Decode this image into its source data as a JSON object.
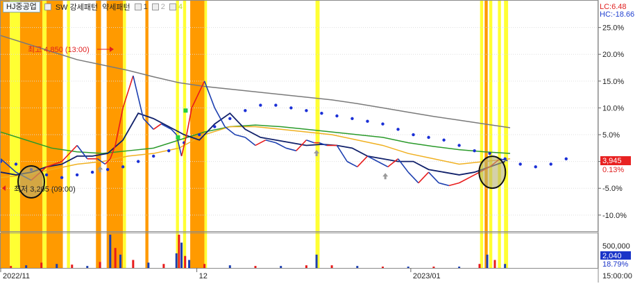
{
  "toolbar": {
    "symbol": "HJ중공업",
    "items": [
      "SW 강세패턴",
      "약세패턴"
    ],
    "series_nums": [
      "1",
      "2",
      "4"
    ],
    "series_colors": [
      "#444444",
      "#aaaaaa",
      "#b8d830"
    ]
  },
  "top_right": {
    "lc_label": "LC:6.48",
    "hc_label": "HC:-18.66",
    "lc_color": "#e02020",
    "hc_color": "#2040d0"
  },
  "annotations": {
    "high_label": "최고 4,850 (13:00)",
    "low_label": "최저 3,205 (09:00)"
  },
  "price_tag": {
    "value": "3,945",
    "pct": "0.13%"
  },
  "volume_tags": {
    "max": "500,000",
    "value": "2,040",
    "pct": "18.79%"
  },
  "time_label": "15:00:00",
  "colors": {
    "band_yellow": "#ffff33",
    "band_orange": "#ff9a00",
    "price_up": "#e81b1b",
    "price_down": "#1c3fb0",
    "dots": "#1a2fd6",
    "ma_gray": "#7a7a7a",
    "ma_green": "#2a9a2a",
    "ma_orange": "#f0b020",
    "ma_navy": "#10206a",
    "ma_pink": "#d040c0"
  },
  "chart_data": {
    "type": "line",
    "y_axis_ticks": [
      "25.0%",
      "20.0%",
      "15.0%",
      "10.0%",
      "5.0%",
      "0.0%",
      "-5.0%",
      "-10.0%"
    ],
    "y_tick_values": [
      25,
      20,
      15,
      10,
      5,
      0,
      -5,
      -10
    ],
    "ylim": [
      -13,
      30
    ],
    "x_axis_labels": [
      "2022/11",
      "12",
      "2023/01"
    ],
    "x_axis_positions": [
      0.0,
      0.385,
      0.805
    ],
    "xlim": [
      0,
      1
    ],
    "volume_axis_tick": "500,000",
    "series": [
      {
        "kind": "price",
        "x": [
          0.0,
          0.03,
          0.06,
          0.09,
          0.12,
          0.15,
          0.17,
          0.19,
          0.205,
          0.215,
          0.225,
          0.24,
          0.26,
          0.28,
          0.3,
          0.315,
          0.325,
          0.335,
          0.345,
          0.355,
          0.365,
          0.375,
          0.385,
          0.4,
          0.42,
          0.44,
          0.46,
          0.48,
          0.5,
          0.52,
          0.54,
          0.56,
          0.58,
          0.6,
          0.615,
          0.625,
          0.64,
          0.66,
          0.68,
          0.7,
          0.72,
          0.74,
          0.76,
          0.78,
          0.8,
          0.82,
          0.84,
          0.86,
          0.88,
          0.9,
          0.92,
          0.94,
          0.96,
          0.98,
          0.995
        ],
        "values": [
          0.5,
          -2.0,
          -3.5,
          -1.0,
          0.0,
          3.0,
          0.5,
          0.5,
          -0.5,
          0.5,
          3.0,
          10.0,
          16.0,
          8.0,
          6.0,
          7.0,
          6.5,
          6.0,
          5.0,
          1.0,
          5.0,
          10.0,
          12.0,
          15.0,
          10.0,
          6.5,
          5.0,
          4.5,
          3.0,
          4.0,
          3.5,
          2.5,
          2.0,
          4.0,
          3.5,
          3.5,
          3.0,
          3.0,
          0.0,
          -1.0,
          1.0,
          0.0,
          -1.0,
          0.5,
          -2.0,
          -4.0,
          -2.0,
          -4.0,
          -4.5,
          -4.0,
          -3.0,
          -2.0,
          -1.0,
          0.5,
          0.13
        ]
      },
      {
        "kind": "ma_gray",
        "x": [
          0.0,
          0.05,
          0.1,
          0.15,
          0.2,
          0.25,
          0.3,
          0.35,
          0.4,
          0.45,
          0.5,
          0.55,
          0.6,
          0.65,
          0.7,
          0.75,
          0.8,
          0.85,
          0.9,
          0.95,
          1.0
        ],
        "values": [
          23.5,
          22.0,
          20.5,
          19.0,
          18.0,
          17.0,
          15.8,
          14.7,
          14.0,
          13.5,
          13.0,
          12.5,
          12.0,
          11.5,
          10.8,
          10.0,
          9.2,
          8.4,
          7.7,
          7.0,
          6.3
        ]
      },
      {
        "kind": "ma_green",
        "x": [
          0.0,
          0.05,
          0.1,
          0.15,
          0.2,
          0.25,
          0.3,
          0.35,
          0.4,
          0.45,
          0.5,
          0.55,
          0.6,
          0.65,
          0.7,
          0.75,
          0.8,
          0.85,
          0.9,
          0.95,
          1.0
        ],
        "values": [
          5.5,
          4.0,
          2.5,
          1.8,
          1.5,
          2.0,
          2.5,
          4.0,
          5.5,
          6.5,
          6.8,
          6.5,
          6.0,
          5.5,
          5.0,
          4.5,
          3.5,
          2.8,
          2.2,
          1.8,
          1.5
        ]
      },
      {
        "kind": "ma_orange",
        "x": [
          0.0,
          0.05,
          0.1,
          0.15,
          0.2,
          0.25,
          0.3,
          0.35,
          0.4,
          0.45,
          0.5,
          0.55,
          0.6,
          0.65,
          0.7,
          0.75,
          0.8,
          0.85,
          0.9,
          0.95,
          1.0
        ],
        "values": [
          -3.0,
          -2.5,
          -1.5,
          -0.5,
          0.0,
          1.0,
          1.5,
          2.5,
          5.0,
          6.5,
          6.5,
          6.0,
          5.5,
          5.0,
          4.0,
          3.0,
          1.5,
          0.5,
          -0.5,
          0.0,
          0.5
        ]
      },
      {
        "kind": "ma_navy",
        "x": [
          0.0,
          0.03,
          0.06,
          0.09,
          0.12,
          0.15,
          0.18,
          0.21,
          0.24,
          0.27,
          0.3,
          0.33,
          0.36,
          0.39,
          0.42,
          0.45,
          0.48,
          0.51,
          0.54,
          0.57,
          0.6,
          0.63,
          0.66,
          0.69,
          0.72,
          0.75,
          0.78,
          0.81,
          0.84,
          0.87,
          0.9,
          0.93,
          0.96,
          0.99
        ],
        "values": [
          -2.0,
          -2.5,
          -2.0,
          -1.0,
          -0.5,
          1.0,
          1.0,
          1.5,
          4.0,
          9.0,
          8.0,
          6.5,
          5.0,
          4.0,
          7.0,
          9.0,
          6.0,
          4.5,
          4.0,
          3.5,
          3.0,
          3.2,
          3.0,
          2.5,
          1.0,
          0.5,
          0.0,
          0.0,
          -1.5,
          -2.0,
          -2.5,
          -2.0,
          -1.0,
          0.0
        ]
      },
      {
        "kind": "dots",
        "x": [
          0.0,
          0.03,
          0.06,
          0.09,
          0.12,
          0.15,
          0.18,
          0.21,
          0.24,
          0.27,
          0.3,
          0.33,
          0.36,
          0.39,
          0.42,
          0.45,
          0.48,
          0.51,
          0.54,
          0.57,
          0.6,
          0.63,
          0.66,
          0.69,
          0.72,
          0.75,
          0.78,
          0.81,
          0.84,
          0.87,
          0.9,
          0.93,
          0.96,
          0.99,
          1.02,
          1.05,
          1.08,
          1.11,
          1.14
        ],
        "values": [
          0.0,
          -0.5,
          -1.5,
          -2.5,
          -3.0,
          -2.5,
          -2.0,
          -1.5,
          -1.0,
          0.0,
          1.0,
          2.0,
          3.5,
          5.0,
          6.5,
          8.0,
          9.5,
          10.5,
          10.5,
          10.0,
          9.5,
          9.0,
          8.5,
          8.0,
          7.5,
          7.0,
          6.0,
          5.0,
          4.5,
          4.0,
          3.0,
          2.0,
          1.5,
          0.5,
          -0.5,
          -1.0,
          -0.5,
          0.5,
          1.0
        ]
      }
    ],
    "bands": [
      {
        "x0": 0.0,
        "x1": 0.018,
        "color": "orange"
      },
      {
        "x0": 0.018,
        "x1": 0.038,
        "color": "yellow"
      },
      {
        "x0": 0.038,
        "x1": 0.082,
        "color": "orange"
      },
      {
        "x0": 0.082,
        "x1": 0.09,
        "color": "yellow"
      },
      {
        "x0": 0.09,
        "x1": 0.122,
        "color": "orange"
      },
      {
        "x0": 0.13,
        "x1": 0.136,
        "color": "yellow"
      },
      {
        "x0": 0.187,
        "x1": 0.197,
        "color": "orange"
      },
      {
        "x0": 0.208,
        "x1": 0.24,
        "color": "orange"
      },
      {
        "x0": 0.24,
        "x1": 0.246,
        "color": "yellow"
      },
      {
        "x0": 0.284,
        "x1": 0.29,
        "color": "orange"
      },
      {
        "x0": 0.344,
        "x1": 0.35,
        "color": "yellow"
      },
      {
        "x0": 0.358,
        "x1": 0.364,
        "color": "yellow"
      },
      {
        "x0": 0.372,
        "x1": 0.4,
        "color": "orange"
      },
      {
        "x0": 0.4,
        "x1": 0.405,
        "color": "yellow"
      },
      {
        "x0": 0.618,
        "x1": 0.626,
        "color": "yellow"
      },
      {
        "x0": 0.941,
        "x1": 0.947,
        "color": "yellow"
      },
      {
        "x0": 0.95,
        "x1": 0.956,
        "color": "orange"
      },
      {
        "x0": 0.959,
        "x1": 0.965,
        "color": "yellow"
      },
      {
        "x0": 0.976,
        "x1": 0.982,
        "color": "yellow"
      },
      {
        "x0": 0.988,
        "x1": 0.996,
        "color": "yellow"
      }
    ],
    "markers": [
      {
        "kind": "circle",
        "x": 0.06,
        "y": -3.8
      },
      {
        "kind": "circle",
        "x": 0.965,
        "y": -2.0
      },
      {
        "kind": "arrow",
        "x": 0.195,
        "y": -1.5
      },
      {
        "kind": "arrow",
        "x": 0.62,
        "y": 1.5
      },
      {
        "kind": "arrow",
        "x": 0.755,
        "y": -2.8
      },
      {
        "kind": "square",
        "x": 0.348,
        "y": 4.5
      },
      {
        "kind": "square",
        "x": 0.363,
        "y": 9.5
      }
    ],
    "volume": {
      "x": [
        0.02,
        0.05,
        0.08,
        0.11,
        0.14,
        0.17,
        0.195,
        0.215,
        0.225,
        0.235,
        0.26,
        0.29,
        0.32,
        0.345,
        0.35,
        0.355,
        0.362,
        0.37,
        0.4,
        0.45,
        0.5,
        0.55,
        0.6,
        0.62,
        0.65,
        0.7,
        0.75,
        0.8,
        0.85,
        0.9,
        0.94,
        0.955,
        0.97,
        0.99
      ],
      "values": [
        30000,
        40000,
        80000,
        60000,
        50000,
        30000,
        90000,
        500000,
        300000,
        200000,
        120000,
        80000,
        60000,
        220000,
        500000,
        380000,
        180000,
        120000,
        60000,
        40000,
        30000,
        30000,
        40000,
        200000,
        40000,
        30000,
        20000,
        20000,
        20000,
        20000,
        60000,
        200000,
        120000,
        60000
      ]
    }
  }
}
